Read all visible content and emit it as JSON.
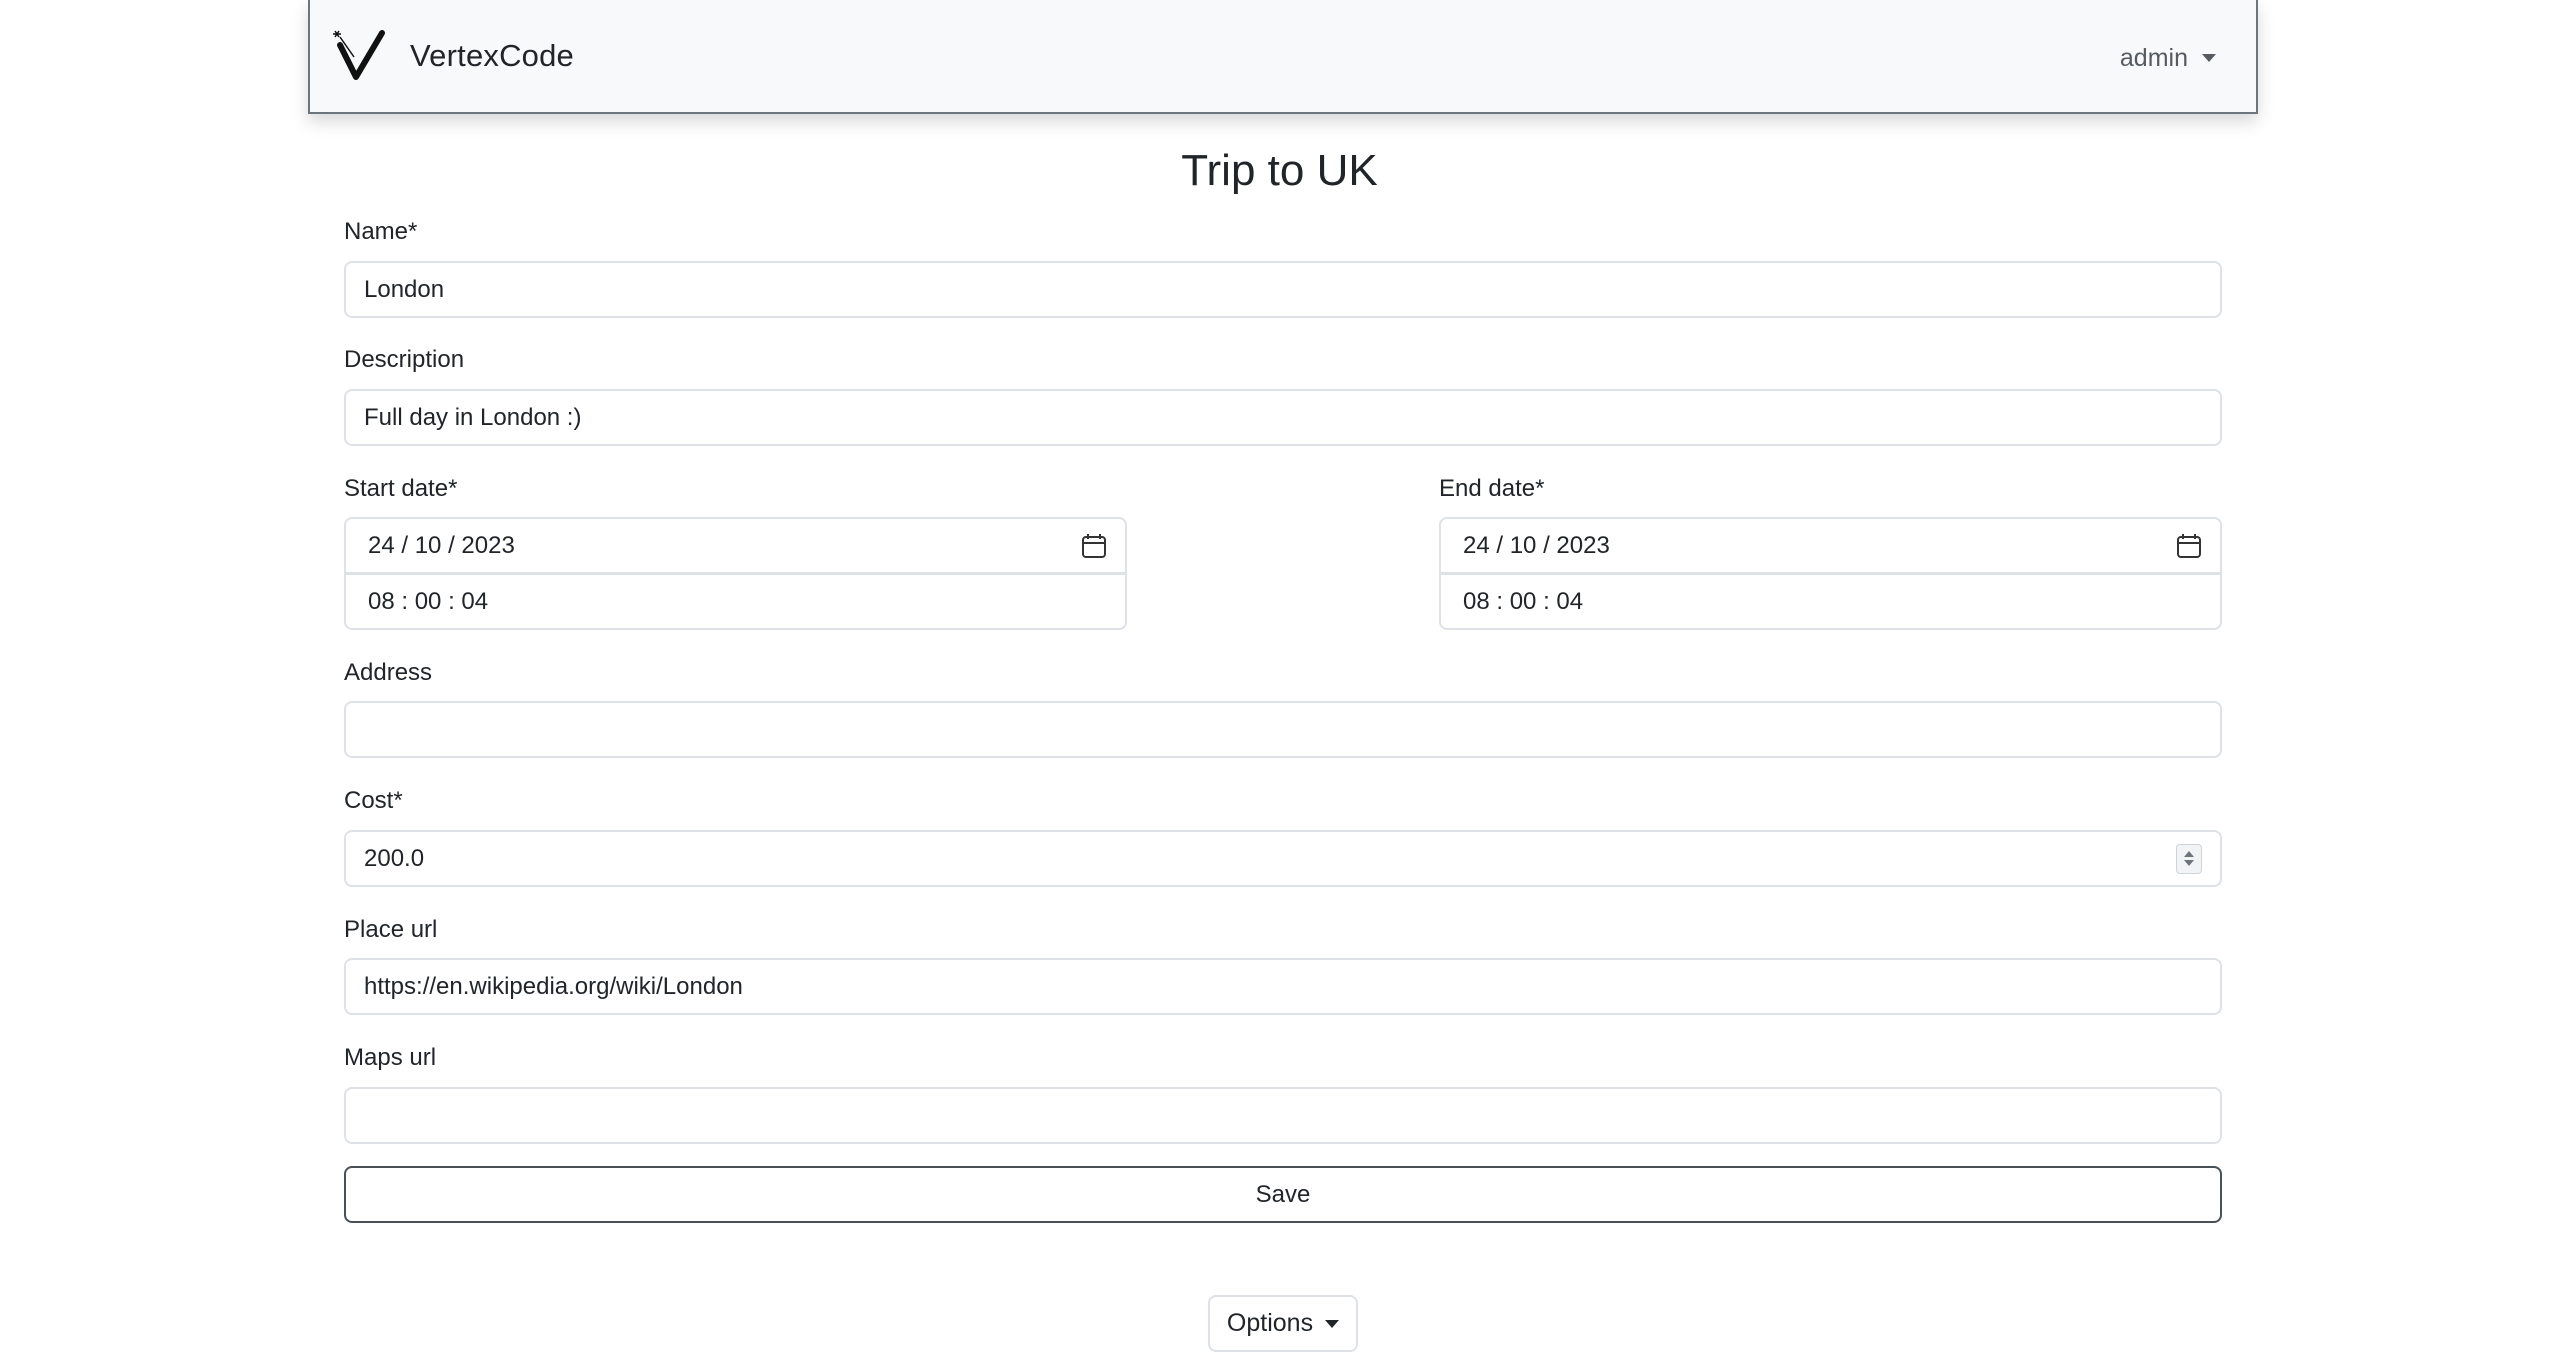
{
  "navbar": {
    "brand_name": "VertexCode",
    "user_label": "admin"
  },
  "page": {
    "title": "Trip to UK"
  },
  "form": {
    "name": {
      "label": "Name*",
      "value": "London"
    },
    "description": {
      "label": "Description",
      "value": "Full day in London :)"
    },
    "start_date": {
      "label": "Start date*",
      "date": "24 / 10 / 2023",
      "time": "08 : 00 : 04"
    },
    "end_date": {
      "label": "End date*",
      "date": "24 / 10 / 2023",
      "time": "08 : 00 : 04"
    },
    "address": {
      "label": "Address",
      "value": ""
    },
    "cost": {
      "label": "Cost*",
      "value": "200.0"
    },
    "place_url": {
      "label": "Place url",
      "value": "https://en.wikipedia.org/wiki/London"
    },
    "maps_url": {
      "label": "Maps url",
      "value": ""
    },
    "save_label": "Save"
  },
  "options": {
    "label": "Options"
  },
  "icons": {
    "logo": "vertexcode-logo",
    "calendar": "calendar-icon",
    "dropdown": "caret-down-icon",
    "spinner": "number-spinner-icon"
  }
}
